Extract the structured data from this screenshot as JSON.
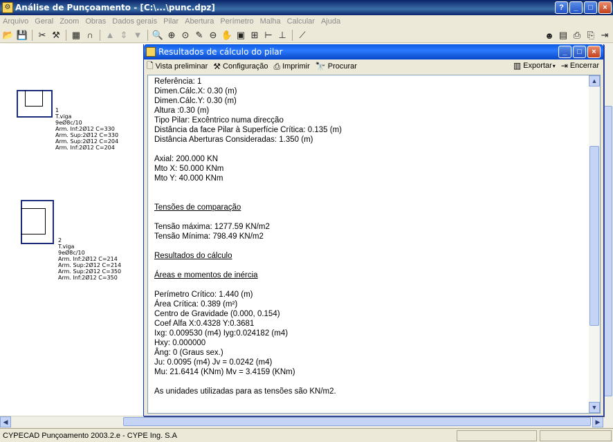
{
  "app": {
    "title": "Análise de Punçoamento - [C:\\...\\punc.dpz]",
    "window_controls": [
      "?",
      "_",
      "□",
      "×"
    ]
  },
  "menu": [
    "Arquivo",
    "Geral",
    "Zoom",
    "Obras",
    "Dados gerais",
    "Pilar",
    "Abertura",
    "Perímetro",
    "Malha",
    "Calcular",
    "Ajuda"
  ],
  "columns": [
    {
      "id": "1",
      "lines": [
        "1",
        "T.viga",
        "9eØ8c/10",
        "Arm. Inf:2Ø12 C=330",
        "Arm. Sup:2Ø12 C=330",
        "Arm. Sup:2Ø12 C=204",
        "Arm. Inf:2Ø12 C=204"
      ]
    },
    {
      "id": "2",
      "lines": [
        "2",
        "T.viga",
        "9eØ8c/10",
        "Arm. Inf:2Ø12 C=214",
        "Arm. Sup:2Ø12 C=214",
        "Arm. Sup:2Ø12 C=350",
        "Arm. Inf:2Ø12 C=350"
      ]
    }
  ],
  "dialog": {
    "title": "Resultados de cálculo do pilar",
    "tools": [
      "Vista preliminar",
      "Configuração",
      "Imprimir",
      "Procurar"
    ],
    "tools_right": [
      "Exportar",
      "Encerrar"
    ],
    "report": {
      "block1": [
        "Referência: 1",
        "Dimen.Cálc.X: 0.30 (m)",
        "Dimen.Cálc.Y: 0.30 (m)",
        "Altura :0.30 (m)",
        "Tipo Pilar: Excêntrico numa direcção",
        "Distância da face Pilar à Superfície Crítica: 0.135 (m)",
        "Distância Aberturas Consideradas: 1.350 (m)"
      ],
      "block2": [
        "Axial: 200.000 KN",
        "Mto X: 50.000 KNm",
        "Mto Y: 40.000 KNm"
      ],
      "heading_tensoes": "Tensões de comparação",
      "block3": [
        "Tensão máxima: 1277.59 KN/m2",
        "Tensão Mínima: 798.49 KN/m2"
      ],
      "heading_resultados": "Resultados do cálculo",
      "heading_areas": "Áreas e momentos de inércia",
      "block4": [
        "Perímetro Crítico: 1.440 (m)",
        "Área Crítica: 0.389 (m²)",
        "Centro de Gravidade (0.000, 0.154)",
        "Coef Alfa X:0.4328 Y:0.3681",
        "Ixg: 0.009530 (m4) Iyg:0.024182 (m4)",
        "Hxy: 0.000000",
        "Âng: 0 (Graus sex.)",
        "Ju: 0.0095 (m4) Jv = 0.0242 (m4)",
        "Mu: 21.6414 (KNm) Mv = 3.4159 (KNm)"
      ],
      "footer_note": "As unidades utilizadas para as tensões são KN/m2."
    }
  },
  "status": {
    "text": "CYPECAD Punçoamento 2003.2.e - CYPE Ing. S.A"
  }
}
